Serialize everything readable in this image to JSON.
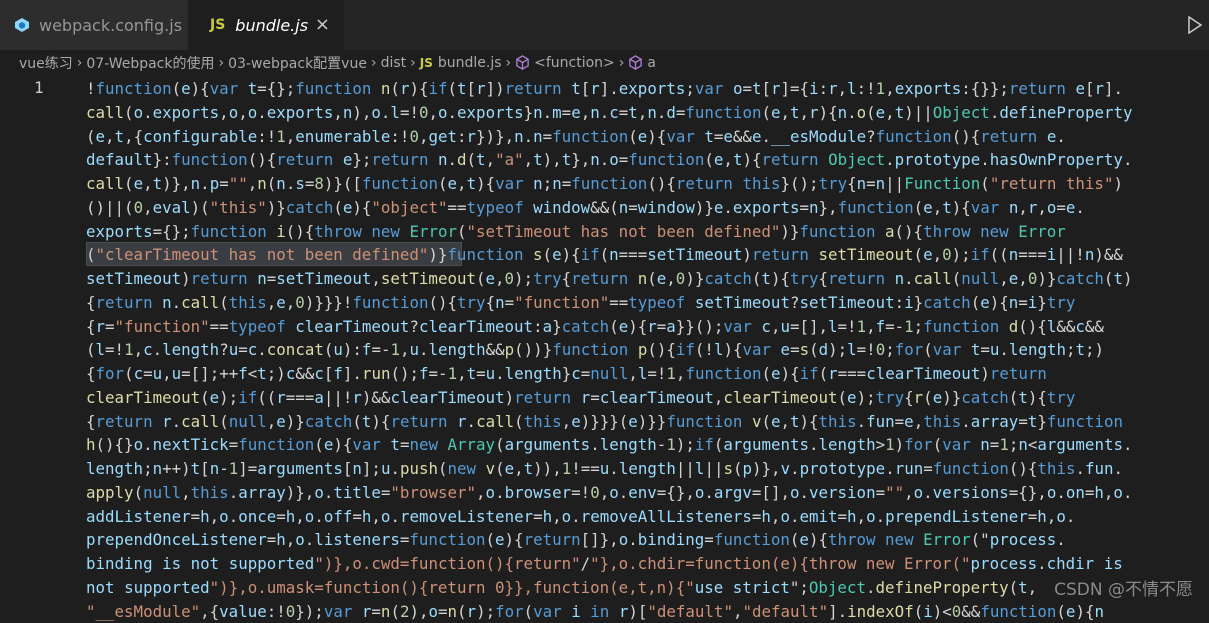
{
  "tabs": [
    {
      "label": "webpack.config.js",
      "active": false,
      "icon": "webpack-cube-icon"
    },
    {
      "label": "bundle.js",
      "active": true,
      "icon": "js-file-icon",
      "icon_text": "JS",
      "close": "×"
    }
  ],
  "breadcrumb": {
    "items": [
      "vue练习",
      "07-Webpack的使用",
      "03-webpack配置vue",
      "dist"
    ],
    "file_icon": "JS",
    "file": "bundle.js",
    "symbol1": "<function>",
    "symbol2": "a",
    "separator": "›"
  },
  "editor": {
    "line_number": "1",
    "lines": [
      "!function(e){var t={};function n(r){if(t[r])return t[r].exports;var o=t[r]={i:r,l:!1,exports:{}};return e[r].",
      "call(o.exports,o,o.exports,n),o.l=!0,o.exports}n.m=e,n.c=t,n.d=function(e,t,r){n.o(e,t)||Object.defineProperty",
      "(e,t,{configurable:!1,enumerable:!0,get:r})},n.n=function(e){var t=e&&e.__esModule?function(){return e.",
      "default}:function(){return e};return n.d(t,\"a\",t),t},n.o=function(e,t){return Object.prototype.hasOwnProperty.",
      "call(e,t)},n.p=\"\",n(n.s=8)}([function(e,t){var n;n=function(){return this}();try{n=n||Function(\"return this\")",
      "()||(0,eval)(\"this\")}catch(e){\"object\"==typeof window&&(n=window)}e.exports=n},function(e,t){var n,r,o=e.",
      "exports={};function i(){throw new Error(\"setTimeout has not been defined\")}function a(){throw new Error",
      "(\"clearTimeout has not been defined\")}function s(e){if(n===setTimeout)return setTimeout(e,0);if((n===i||!n)&&",
      "setTimeout)return n=setTimeout,setTimeout(e,0);try{return n(e,0)}catch(t){try{return n.call(null,e,0)}catch(t)",
      "{return n.call(this,e,0)}}}!function(){try{n=\"function\"==typeof setTimeout?setTimeout:i}catch(e){n=i}try",
      "{r=\"function\"==typeof clearTimeout?clearTimeout:a}catch(e){r=a}}();var c,u=[],l=!1,f=-1;function d(){l&&c&&",
      "(l=!1,c.length?u=c.concat(u):f=-1,u.length&&p())}function p(){if(!l){var e=s(d);l=!0;for(var t=u.length;t;)",
      "{for(c=u,u=[];++f<t;)c&&c[f].run();f=-1,t=u.length}c=null,l=!1,function(e){if(r===clearTimeout)return",
      "clearTimeout(e);if((r===a||!r)&&clearTimeout)return r=clearTimeout,clearTimeout(e);try{r(e)}catch(t){try",
      "{return r.call(null,e)}catch(t){return r.call(this,e)}}}(e)}}function v(e,t){this.fun=e,this.array=t}function",
      "h(){}o.nextTick=function(e){var t=new Array(arguments.length-1);if(arguments.length>1)for(var n=1;n<arguments.",
      "length;n++)t[n-1]=arguments[n];u.push(new v(e,t)),1!==u.length||l||s(p)},v.prototype.run=function(){this.fun.",
      "apply(null,this.array)},o.title=\"browser\",o.browser=!0,o.env={},o.argv=[],o.version=\"\",o.versions={},o.on=h,o.",
      "addListener=h,o.once=h,o.off=h,o.removeListener=h,o.removeAllListeners=h,o.emit=h,o.prependListener=h,o.",
      "prependOnceListener=h,o.listeners=function(e){return[]},o.binding=function(e){throw new Error(\"process.",
      "binding is not supported\")},o.cwd=function(){return\"/\"},o.chdir=function(e){throw new Error(\"process.chdir is",
      "not supported\")},o.umask=function(){return 0}},function(e,t,n){\"use strict\";Object.defineProperty(t,",
      "\"__esModule\",{value:!0});var r=n(2),o=n(r);for(var i in r)[\"default\",\"default\"].indexOf(i)<0&&function(e){n"
    ]
  },
  "watermark": "CSDN @不情不愿",
  "colors": {
    "keyword": "#569cd6",
    "identifier": "#9cdcfe",
    "function": "#dcdcaa",
    "string": "#ce9178",
    "type": "#4ec9b0",
    "text": "#d4d4d4"
  }
}
